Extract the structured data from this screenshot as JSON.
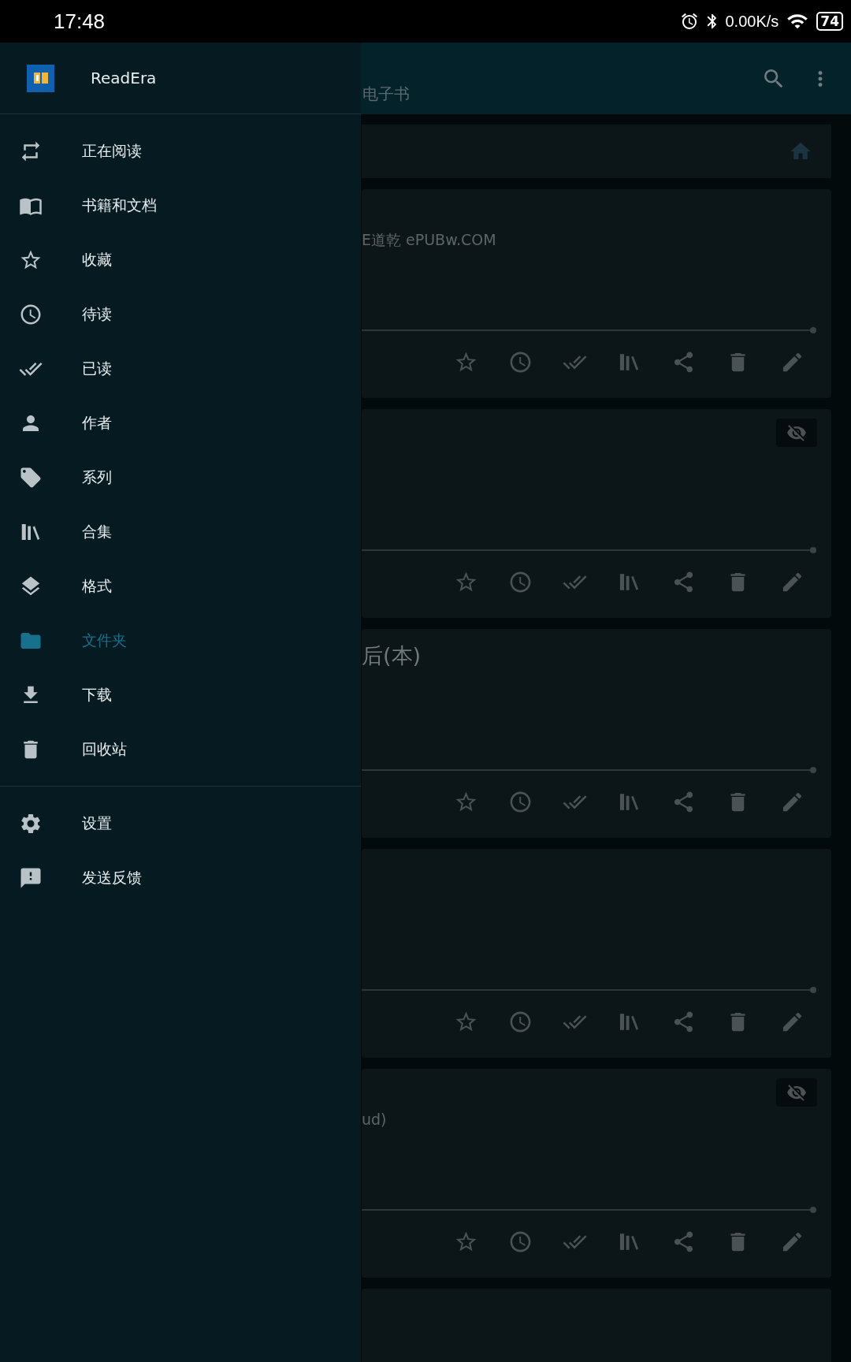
{
  "status_bar": {
    "time": "17:48",
    "net_speed": "0.00K/s",
    "battery": "74"
  },
  "app_bar": {
    "subtitle": "电子书"
  },
  "cards": [
    {
      "kind": "author",
      "text": "E道乾 ePUBw.COM",
      "level": 1
    },
    {
      "kind": "none",
      "hidden": true,
      "level": 1
    },
    {
      "kind": "title",
      "text": "后(本)",
      "level": 1
    },
    {
      "kind": "none",
      "level": 1
    },
    {
      "kind": "author",
      "text": "ud)",
      "hidden": true,
      "level": 1
    },
    {
      "kind": "partial"
    }
  ],
  "drawer": {
    "app_name": "ReadEra",
    "items": [
      {
        "label": "正在阅读",
        "selected": false
      },
      {
        "label": "书籍和文档",
        "selected": false
      },
      {
        "label": "收藏",
        "selected": false
      },
      {
        "label": "待读",
        "selected": false
      },
      {
        "label": "已读",
        "selected": false
      },
      {
        "label": "作者",
        "selected": false
      },
      {
        "label": "系列",
        "selected": false
      },
      {
        "label": "合集",
        "selected": false
      },
      {
        "label": "格式",
        "selected": false
      },
      {
        "label": "文件夹",
        "selected": true
      },
      {
        "label": "下载",
        "selected": false
      },
      {
        "label": "回收站",
        "selected": false
      }
    ],
    "footer_items": [
      {
        "label": "设置",
        "selected": false
      },
      {
        "label": "发送反馈",
        "selected": false
      }
    ]
  }
}
